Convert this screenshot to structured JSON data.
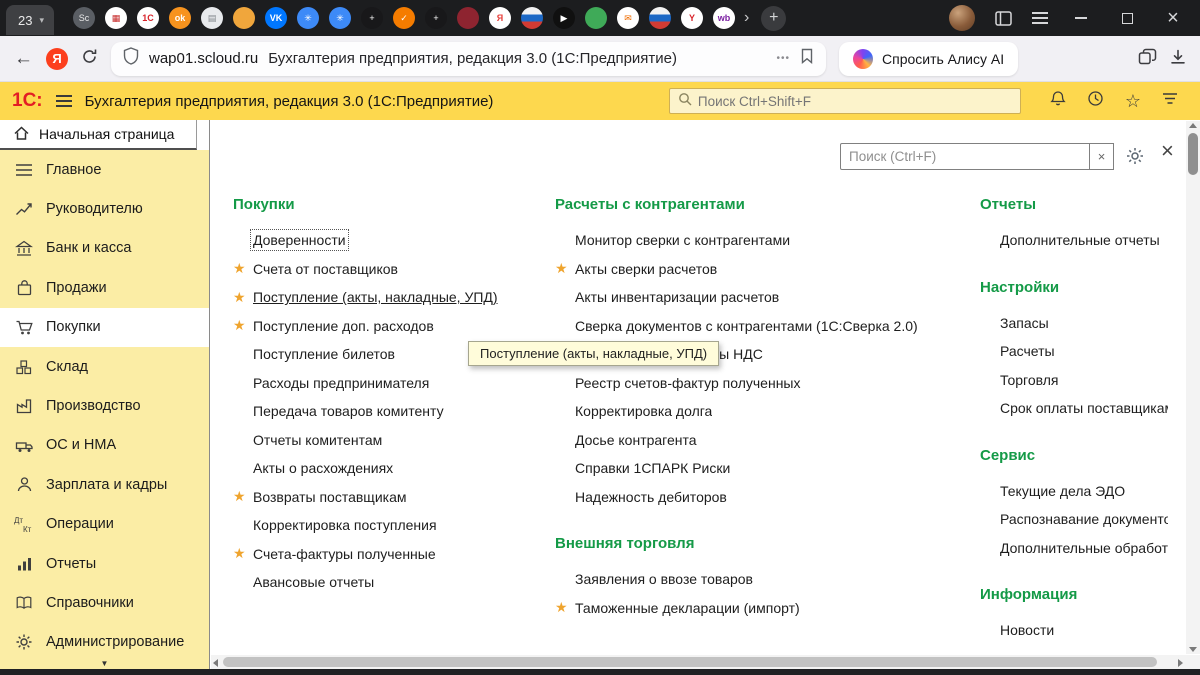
{
  "icons": {
    "star": "★",
    "star_outline": "☆",
    "close": "×",
    "clear": "×",
    "chevron_down": "▾",
    "triangle_down": "▼",
    "back": "←",
    "dots": "•••",
    "new_tab_plus": "+",
    "overflow_chevron": "›",
    "yandex_letter": "Я"
  },
  "browser": {
    "active_tab_label": "23",
    "tabs": [
      {
        "css": "background:#5a5e64;color:#e8e8e8",
        "glyph": "Sc"
      },
      {
        "css": "background:#ffffff;color:#c62828",
        "glyph": "▦"
      },
      {
        "css": "background:#ffffff;color:#d8232a;font-weight:bold",
        "glyph": "1С"
      },
      {
        "css": "background:#f7931e;color:#ffffff;font-weight:bold",
        "glyph": "ok"
      },
      {
        "css": "background:#e8eaed;color:#80868b",
        "glyph": "▤"
      },
      {
        "css": "background:#f0a63c;color:#ffffff",
        "glyph": ""
      },
      {
        "css": "background:#0077ff;color:#ffffff;font-weight:bold",
        "glyph": "VK"
      },
      {
        "css": "background:#3d8af7;color:#ffffff",
        "glyph": "✳"
      },
      {
        "css": "background:#3d8af7;color:#ffffff",
        "glyph": "✳"
      },
      {
        "css": "background:#18181a;color:#ffffff",
        "glyph": "+"
      },
      {
        "css": "background:#f57c00;color:#ffffff",
        "glyph": "✓"
      },
      {
        "css": "background:#18181a;color:#ffffff",
        "glyph": "+"
      },
      {
        "css": "background:#8e2430;color:#ffffff",
        "glyph": ""
      },
      {
        "css": "background:#ffffff;color:#e8413c;font-weight:bold",
        "glyph": "Я"
      },
      {
        "css": "background:linear-gradient(to bottom,#f2f2f2 33%,#1c68c5 33% 66%,#d23b33 66%)",
        "glyph": ""
      },
      {
        "css": "background:#101010;color:#ffffff",
        "glyph": "▶"
      },
      {
        "css": "background:#3faa58;color:#ffffff",
        "glyph": ""
      },
      {
        "css": "background:#ffffff;color:#ef6c00",
        "glyph": "✉"
      },
      {
        "css": "background:linear-gradient(to bottom,#f2f2f2 33%,#1c68c5 33% 66%,#d23b33 66%)",
        "glyph": ""
      },
      {
        "css": "background:#ffffff;color:#d8232a;font-weight:bold",
        "glyph": "Y"
      },
      {
        "css": "background:#ffffff;color:#7b1fa2;font-weight:bold",
        "glyph": "wb"
      }
    ],
    "toolbar": {
      "url": "wap01.scloud.ru",
      "page_title": "Бухгалтерия предприятия, редакция 3.0 (1С:Предприятие)",
      "alice_label": "Спросить Алису AI"
    }
  },
  "app": {
    "logo": "1С:",
    "title": "Бухгалтерия предприятия, редакция 3.0  (1С:Предприятие)",
    "search_placeholder": "Поиск Ctrl+Shift+F",
    "home_tab": "Начальная страница",
    "sidebar": [
      {
        "label": "Главное"
      },
      {
        "label": "Руководителю"
      },
      {
        "label": "Банк и касса"
      },
      {
        "label": "Продажи"
      },
      {
        "label": "Покупки"
      },
      {
        "label": "Склад"
      },
      {
        "label": "Производство"
      },
      {
        "label": "ОС и НМА"
      },
      {
        "label": "Зарплата и кадры"
      },
      {
        "label": "Операции"
      },
      {
        "label": "Отчеты"
      },
      {
        "label": "Справочники"
      },
      {
        "label": "Администрирование"
      }
    ]
  },
  "panel": {
    "search_placeholder": "Поиск (Ctrl+F)",
    "tooltip": "Поступление (акты, накладные, УПД)",
    "col1": {
      "title": "Покупки",
      "items": [
        {
          "label": "Доверенности",
          "starred": false
        },
        {
          "label": "Счета от поставщиков",
          "starred": true
        },
        {
          "label": "Поступление (акты, накладные, УПД)",
          "starred": true
        },
        {
          "label": "Поступление доп. расходов",
          "starred": true
        },
        {
          "label": "Поступление билетов",
          "starred": false
        },
        {
          "label": "Расходы предпринимателя",
          "starred": false
        },
        {
          "label": "Передача товаров комитенту",
          "starred": false
        },
        {
          "label": "Отчеты комитентам",
          "starred": false
        },
        {
          "label": "Акты о расхождениях",
          "starred": false
        },
        {
          "label": "Возвраты поставщикам",
          "starred": true
        },
        {
          "label": "Корректировка поступления",
          "starred": false
        },
        {
          "label": "Счета-фактуры полученные",
          "starred": true
        },
        {
          "label": "Авансовые отчеты",
          "starred": false
        }
      ]
    },
    "col2": [
      {
        "title": "Расчеты с контрагентами",
        "items": [
          {
            "label": "Монитор сверки с контрагентами",
            "starred": false
          },
          {
            "label": "Акты сверки расчетов",
            "starred": true
          },
          {
            "label": "Акты инвентаризации расчетов",
            "starred": false
          },
          {
            "label": "Сверка документов с контрагентами (1С:Сверка 2.0)",
            "starred": false
          },
          {
            "label": "Подтверждение уплаты НДС",
            "starred": false
          },
          {
            "label": "Реестр счетов-фактур полученных",
            "starred": false
          },
          {
            "label": "Корректировка долга",
            "starred": false
          },
          {
            "label": "Досье контрагента",
            "starred": false
          },
          {
            "label": "Справки 1СПАРК Риски",
            "starred": false
          },
          {
            "label": "Надежность дебиторов",
            "starred": false
          }
        ]
      },
      {
        "title": "Внешняя торговля",
        "items": [
          {
            "label": "Заявления о ввозе товаров",
            "starred": false
          },
          {
            "label": "Таможенные декларации (импорт)",
            "starred": true
          }
        ]
      }
    ],
    "col3": [
      {
        "title": "Отчеты",
        "items": [
          {
            "label": "Дополнительные отчеты",
            "starred": false
          }
        ]
      },
      {
        "title": "Настройки",
        "items": [
          {
            "label": "Запасы",
            "starred": false
          },
          {
            "label": "Расчеты",
            "starred": false
          },
          {
            "label": "Торговля",
            "starred": false
          },
          {
            "label": "Срок оплаты поставщикам",
            "starred": false
          }
        ]
      },
      {
        "title": "Сервис",
        "items": [
          {
            "label": "Текущие дела ЭДО",
            "starred": false
          },
          {
            "label": "Распознавание документов",
            "starred": false
          },
          {
            "label": "Дополнительные обработки",
            "starred": false
          }
        ]
      },
      {
        "title": "Информация",
        "items": [
          {
            "label": "Новости",
            "starred": false
          }
        ]
      }
    ]
  }
}
